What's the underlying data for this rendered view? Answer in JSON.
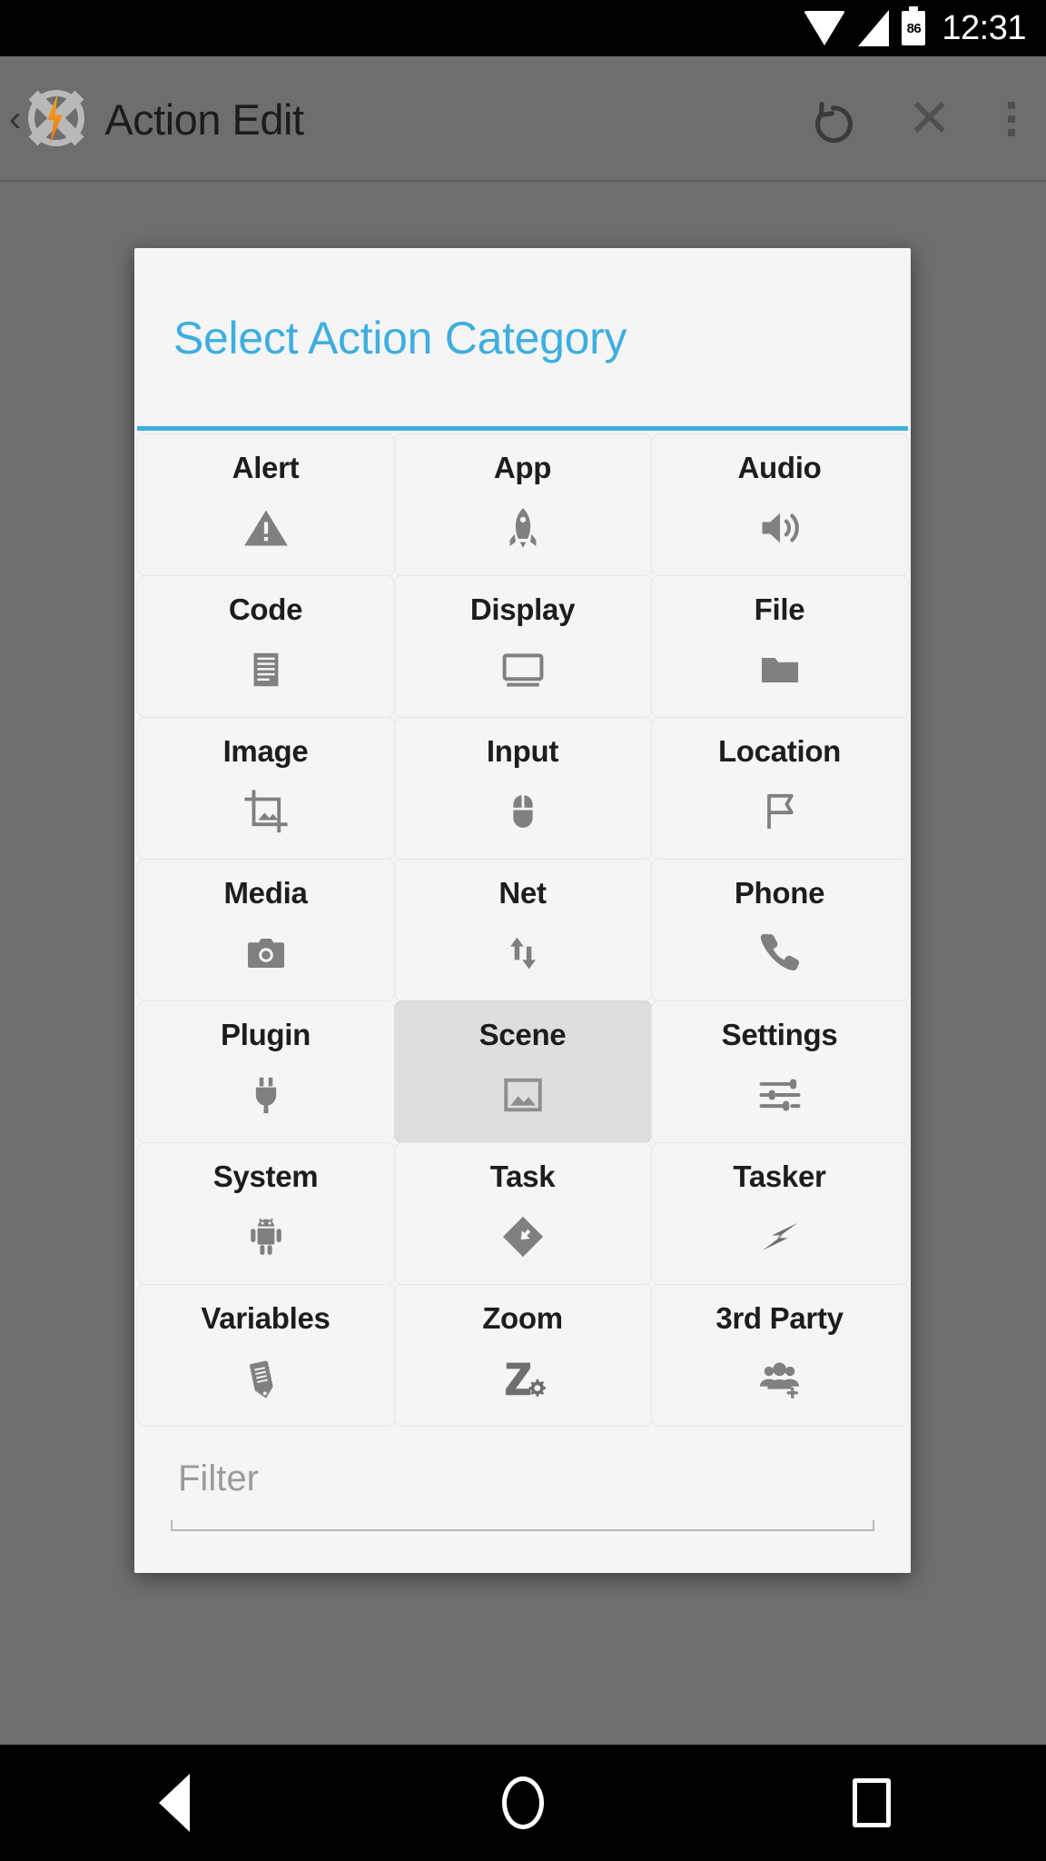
{
  "status_bar": {
    "time": "12:31",
    "battery_level": "86",
    "icons": [
      "wifi-icon",
      "signal-icon",
      "battery-icon"
    ]
  },
  "action_bar": {
    "back_glyph": "‹",
    "app_icon": "tasker-logo-icon",
    "title": "Action Edit",
    "undo_icon": "undo-icon",
    "close_icon": "✕",
    "overflow_icon": "overflow-menu-icon"
  },
  "dialog": {
    "title": "Select Action Category",
    "accent_color": "#3eaee0",
    "selected_category": "Scene",
    "categories": [
      {
        "label": "Alert",
        "icon": "warning-triangle-icon",
        "selected": false
      },
      {
        "label": "App",
        "icon": "rocket-icon",
        "selected": false
      },
      {
        "label": "Audio",
        "icon": "speaker-volume-icon",
        "selected": false
      },
      {
        "label": "Code",
        "icon": "document-lines-icon",
        "selected": false
      },
      {
        "label": "Display",
        "icon": "monitor-icon",
        "selected": false
      },
      {
        "label": "File",
        "icon": "folder-icon",
        "selected": false
      },
      {
        "label": "Image",
        "icon": "crop-image-icon",
        "selected": false
      },
      {
        "label": "Input",
        "icon": "mouse-icon",
        "selected": false
      },
      {
        "label": "Location",
        "icon": "flag-icon",
        "selected": false
      },
      {
        "label": "Media",
        "icon": "camera-icon",
        "selected": false
      },
      {
        "label": "Net",
        "icon": "up-down-arrows-icon",
        "selected": false
      },
      {
        "label": "Phone",
        "icon": "phone-handset-icon",
        "selected": false
      },
      {
        "label": "Plugin",
        "icon": "power-plug-icon",
        "selected": false
      },
      {
        "label": "Scene",
        "icon": "picture-frame-icon",
        "selected": true
      },
      {
        "label": "Settings",
        "icon": "sliders-tune-icon",
        "selected": false
      },
      {
        "label": "System",
        "icon": "android-robot-icon",
        "selected": false
      },
      {
        "label": "Task",
        "icon": "diamond-arrow-icon",
        "selected": false
      },
      {
        "label": "Tasker",
        "icon": "lightning-bolt-icon",
        "selected": false
      },
      {
        "label": "Variables",
        "icon": "pencil-icon",
        "selected": false
      },
      {
        "label": "Zoom",
        "icon": "z-gear-icon",
        "selected": false
      },
      {
        "label": "3rd Party",
        "icon": "people-add-icon",
        "selected": false
      }
    ],
    "filter": {
      "placeholder": "Filter",
      "value": ""
    }
  },
  "nav_bar": {
    "back_label": "back-triangle-icon",
    "home_label": "home-circle-icon",
    "recents_label": "recents-square-icon"
  }
}
